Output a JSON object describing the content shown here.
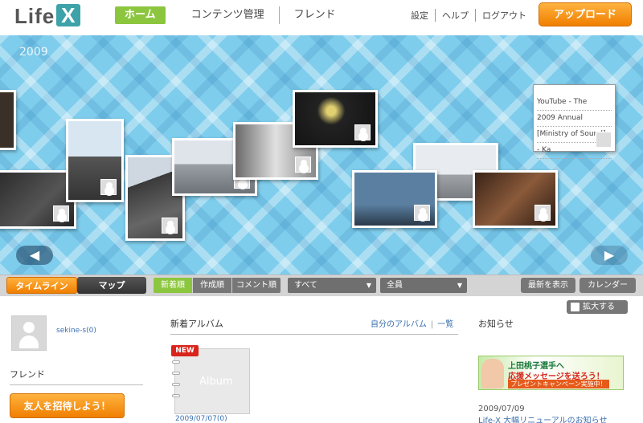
{
  "header": {
    "logo_text": "Life",
    "logo_mark": "X",
    "nav": [
      "ホーム",
      "コンテンツ管理",
      "フレンド"
    ],
    "util": [
      "設定",
      "ヘルプ",
      "ログアウト"
    ],
    "upload_label": "アップロード"
  },
  "timeline": {
    "year": "2009",
    "note_lines": [
      "YouTube - The",
      "2009 Annual",
      "[Ministry of Sound]",
      "- Ka"
    ],
    "prev_icon": "arrow-left-icon",
    "next_icon": "arrow-right-icon"
  },
  "toolbar": {
    "view_tabs": [
      "タイムライン",
      "マップ"
    ],
    "sort": [
      "新着順",
      "作成順",
      "コメント順"
    ],
    "filter_type": "すべて",
    "filter_user": "全員",
    "latest_label": "最新を表示",
    "calendar_label": "カレンダー"
  },
  "bottom": {
    "expand_label": "拡大する",
    "username": "sekine-s(0)",
    "friends_heading": "フレンド",
    "invite_label": "友人を招待しよう！",
    "albums_heading": "新着アルバム",
    "my_albums": "自分のアルバム",
    "list_link": "一覧",
    "new_badge": "NEW",
    "album_label": "Album",
    "album_date": "2009/07/07(0)",
    "news_heading": "お知らせ",
    "banner": {
      "line1": "上田桃子選手へ",
      "line2": "応援メッセージを送ろう！",
      "line3": "プレゼントキャンペーン実施中！"
    },
    "news_date": "2009/07/09",
    "news_title": "Life-X 大幅リニューアルのお知らせ"
  },
  "colors": {
    "accent_green": "#8cc63f",
    "accent_orange": "#f07f00",
    "sky_blue": "#7fcdec",
    "link_blue": "#3a6fb0"
  }
}
